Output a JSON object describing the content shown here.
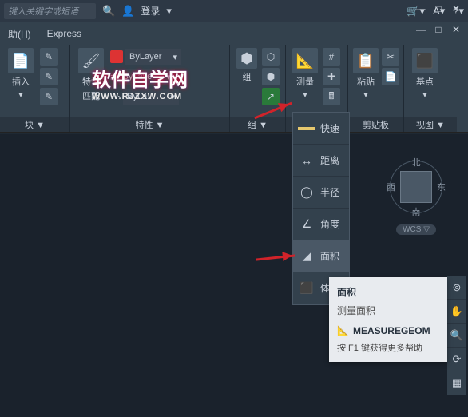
{
  "topbar": {
    "search_placeholder": "键入关键字或短语",
    "login": "登录"
  },
  "menubar": {
    "help": "助(H)",
    "express": "Express"
  },
  "window": {
    "min": "—",
    "max": "□",
    "close": "✕"
  },
  "ribbon": {
    "block": {
      "insert": "插入",
      "label": "块 ▼"
    },
    "properties": {
      "title": "特性",
      "match": "匹配",
      "bylayer1": "ByLayer",
      "bylayer2": "ByLayer",
      "bylayer3": "ByLa...",
      "label": "特性 ▼"
    },
    "group": {
      "title": "组",
      "label": "组 ▼"
    },
    "measure": {
      "title": "测量",
      "label": ""
    },
    "clipboard": {
      "paste": "粘贴",
      "label": "剪贴板"
    },
    "view": {
      "base": "基点",
      "label": "视图 ▼"
    }
  },
  "measure_flyout": {
    "quick": "快速",
    "distance": "距离",
    "radius": "半径",
    "angle": "角度",
    "area": "面积",
    "volume": "体"
  },
  "tooltip": {
    "title": "面积",
    "desc": "测量面积",
    "command": "MEASUREGEOM",
    "help": "按 F1 键获得更多帮助"
  },
  "viewcube": {
    "n": "北",
    "s": "南",
    "e": "东",
    "w": "西",
    "wcs": "WCS ▽"
  },
  "watermark": {
    "title": "软件自学网",
    "url": "WWW.RJZXW.COM"
  }
}
